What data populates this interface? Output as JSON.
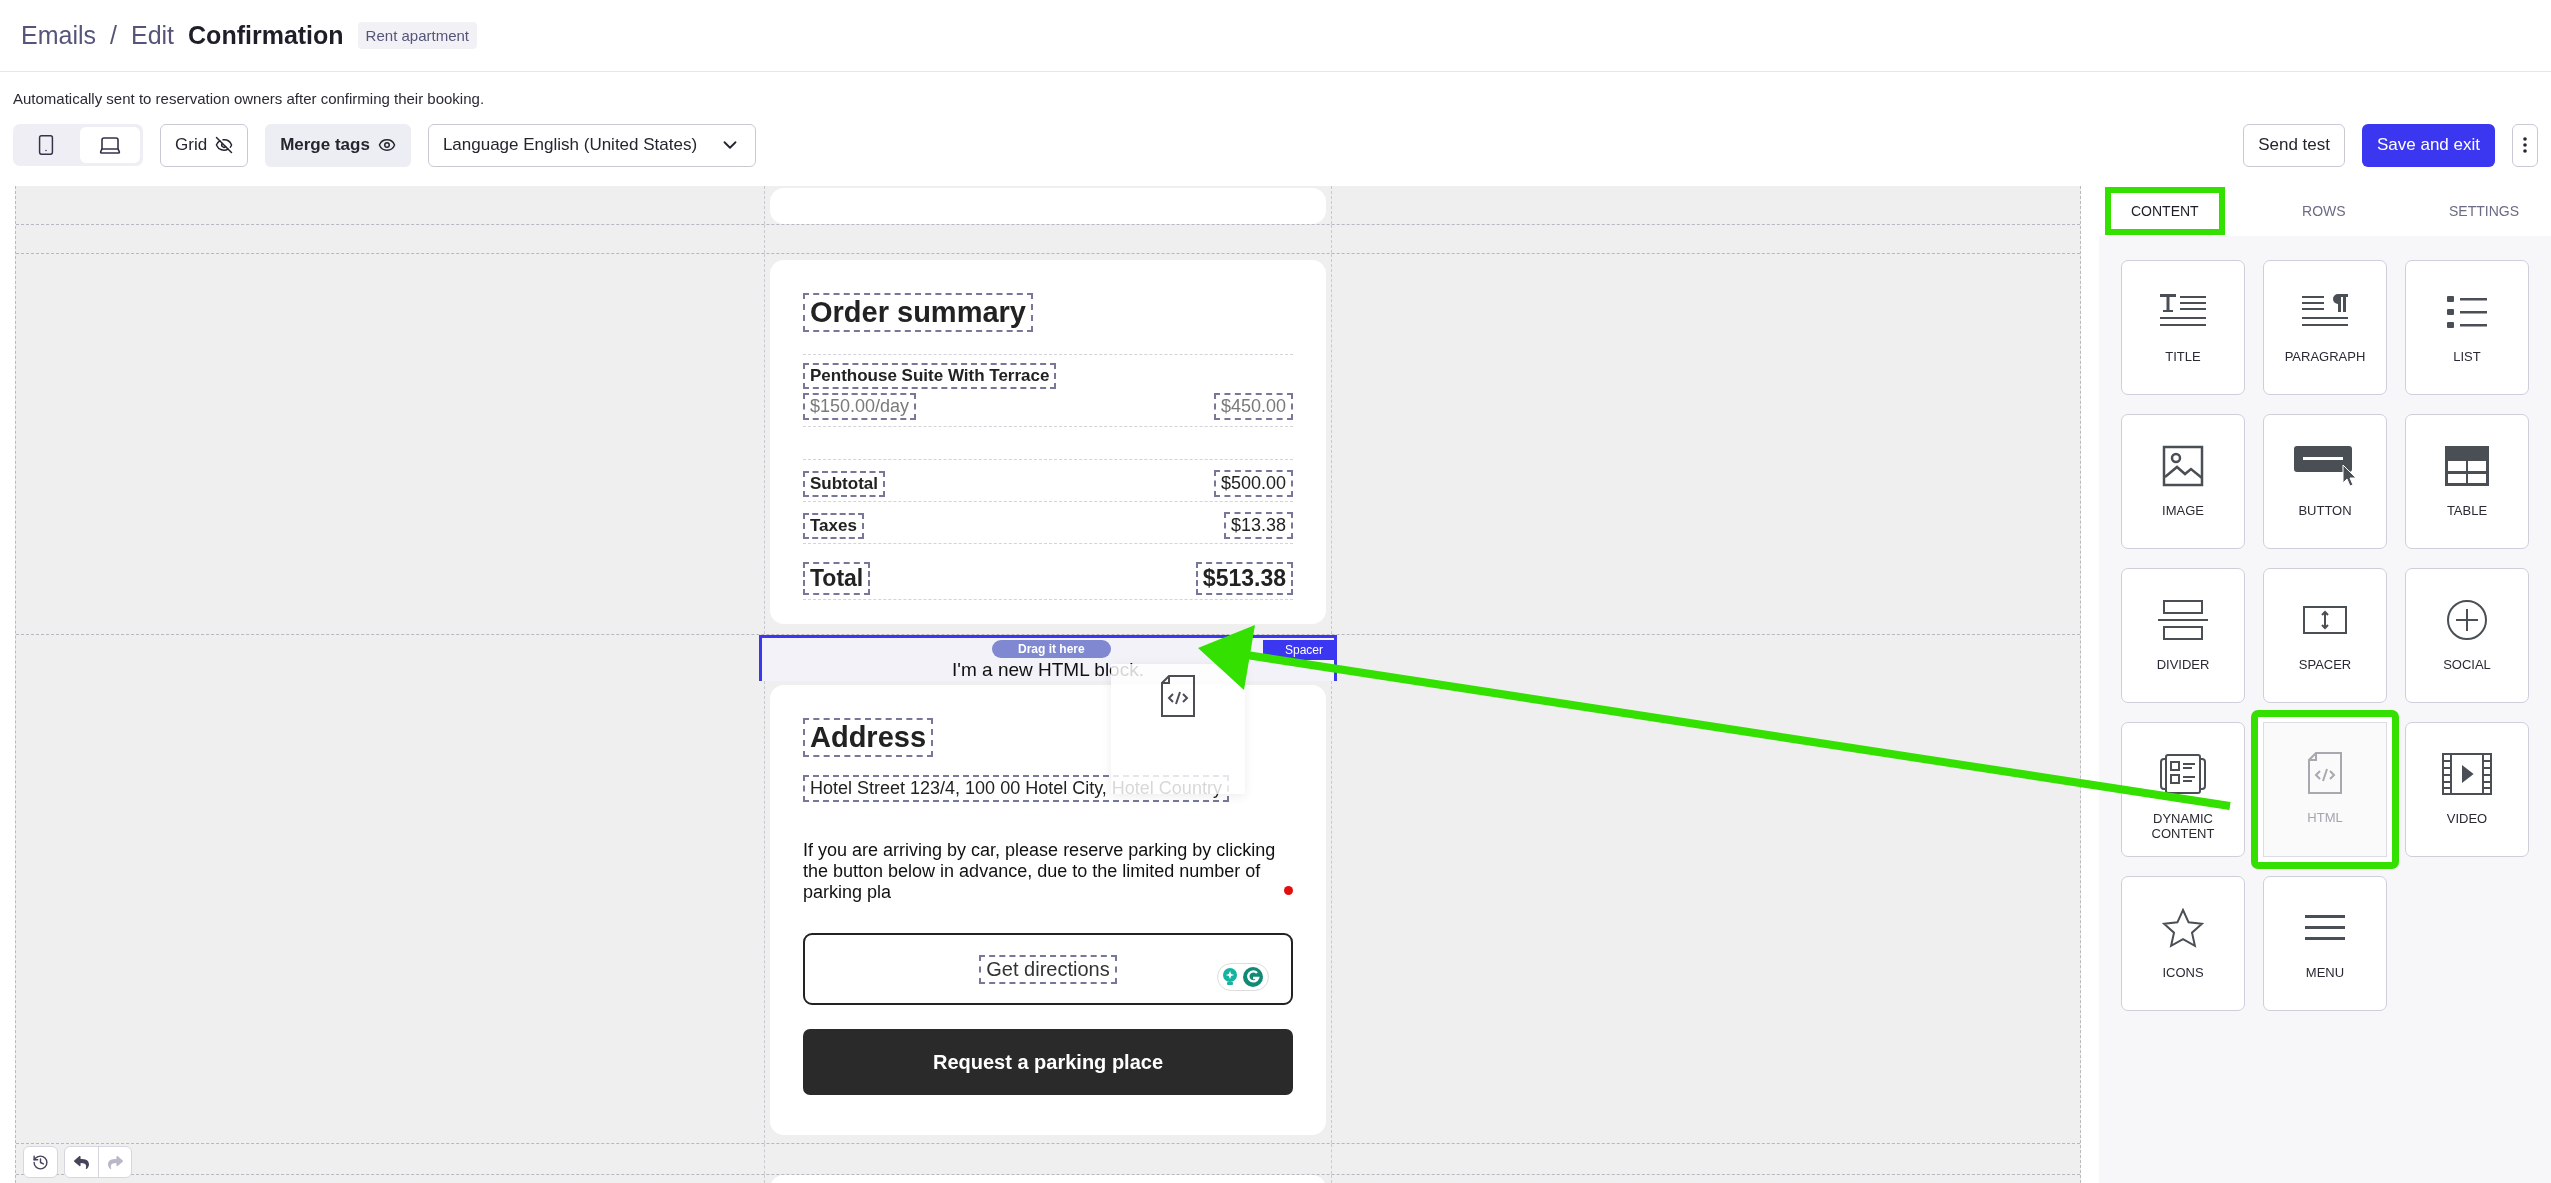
{
  "header": {
    "crumbs": [
      "Emails",
      "Edit"
    ],
    "separator": "/",
    "title": "Confirmation",
    "tag": "Rent apartment"
  },
  "description": "Automatically sent to reservation owners after confirming their booking.",
  "toolbar": {
    "views": [
      {
        "kind": "mobile",
        "selected": false
      },
      {
        "kind": "desktop",
        "selected": true
      }
    ],
    "grid": {
      "label": "Grid",
      "on": false
    },
    "merge_tags": {
      "label": "Merge tags",
      "on": true
    },
    "language": "Language English (United States)",
    "send_test": "Send test",
    "save": "Save and exit"
  },
  "order_summary": {
    "title": "Order summary",
    "item": {
      "name": "Penthouse Suite With Terrace",
      "unit_price": "$150.00/day",
      "amount": "$450.00"
    },
    "totals": [
      {
        "label": "Subtotal",
        "value": "$500.00",
        "kind": "normal"
      },
      {
        "label": "Taxes",
        "value": "$13.38",
        "kind": "normal"
      },
      {
        "label": "Total",
        "value": "$513.38",
        "kind": "grand"
      }
    ]
  },
  "html_block": {
    "text": "I'm a new HTML block.",
    "drop_hint": "Drag it here",
    "badge": "Spacer"
  },
  "address": {
    "title": "Address",
    "line": "Hotel Street 123/4, 100 00 Hotel City, Hotel Country",
    "paragraph": "If you are arriving by car, please reserve parking by clicking the button below in advance, due to the limited number of parking pla",
    "buttons": [
      {
        "label": "Get directions",
        "kind": "outline"
      },
      {
        "label": "Request a parking place",
        "kind": "filled"
      }
    ]
  },
  "panel": {
    "tabs": [
      {
        "label": "CONTENT",
        "selected": true,
        "highlighted": true
      },
      {
        "label": "ROWS",
        "selected": false,
        "highlighted": false
      },
      {
        "label": "SETTINGS",
        "selected": false,
        "highlighted": false
      }
    ],
    "blocks": [
      {
        "label": "TITLE",
        "kind": "title",
        "highlighted": false,
        "dragging": false
      },
      {
        "label": "PARAGRAPH",
        "kind": "paragraph",
        "highlighted": false,
        "dragging": false
      },
      {
        "label": "LIST",
        "kind": "list",
        "highlighted": false,
        "dragging": false
      },
      {
        "label": "IMAGE",
        "kind": "image",
        "highlighted": false,
        "dragging": false
      },
      {
        "label": "BUTTON",
        "kind": "button",
        "highlighted": false,
        "dragging": false
      },
      {
        "label": "TABLE",
        "kind": "table",
        "highlighted": false,
        "dragging": false
      },
      {
        "label": "DIVIDER",
        "kind": "divider",
        "highlighted": false,
        "dragging": false
      },
      {
        "label": "SPACER",
        "kind": "spacer",
        "highlighted": false,
        "dragging": false
      },
      {
        "label": "SOCIAL",
        "kind": "social",
        "highlighted": false,
        "dragging": false
      },
      {
        "label": "DYNAMIC CONTENT",
        "kind": "dynamic",
        "highlighted": false,
        "dragging": false
      },
      {
        "label": "HTML",
        "kind": "html",
        "highlighted": true,
        "dragging": true
      },
      {
        "label": "VIDEO",
        "kind": "video",
        "highlighted": false,
        "dragging": false
      },
      {
        "label": "ICONS",
        "kind": "icons",
        "highlighted": false,
        "dragging": false
      },
      {
        "label": "MENU",
        "kind": "menu",
        "highlighted": false,
        "dragging": false
      }
    ]
  }
}
